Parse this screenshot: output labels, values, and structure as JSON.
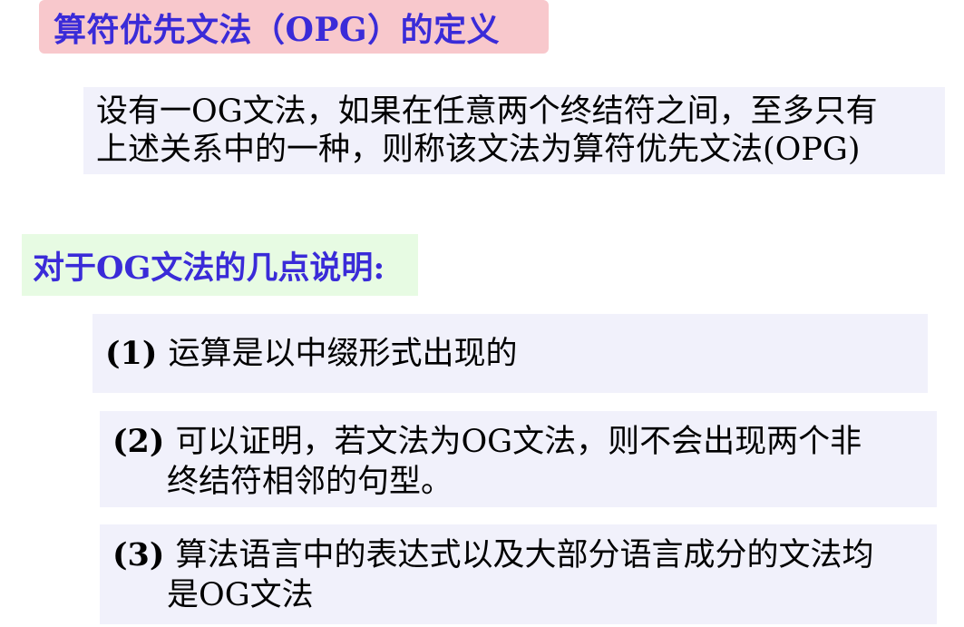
{
  "title": "算符优先文法（OPG）的定义",
  "definition": {
    "line1": "设有一OG文法，如果在任意两个终结符之间，至多只有",
    "line2": "上述关系中的一种，则称该文法为算符优先文法(OPG)"
  },
  "notes_heading": "对于OG文法的几点说明:",
  "items": [
    {
      "number": "(1)",
      "line1": "运算是以中缀形式出现的"
    },
    {
      "number": "(2)",
      "line1": "可以证明，若文法为OG文法，则不会出现两个非",
      "line2": "终结符相邻的句型。"
    },
    {
      "number": "(3)",
      "line1": "算法语言中的表达式以及大部分语言成分的文法均",
      "line2": "是OG文法"
    }
  ],
  "colors": {
    "title_bg": "#f8c8cc",
    "heading_text": "#3a2bd8",
    "panel_bg": "#f1f1fb",
    "notes_bg": "#e7fbe3"
  }
}
